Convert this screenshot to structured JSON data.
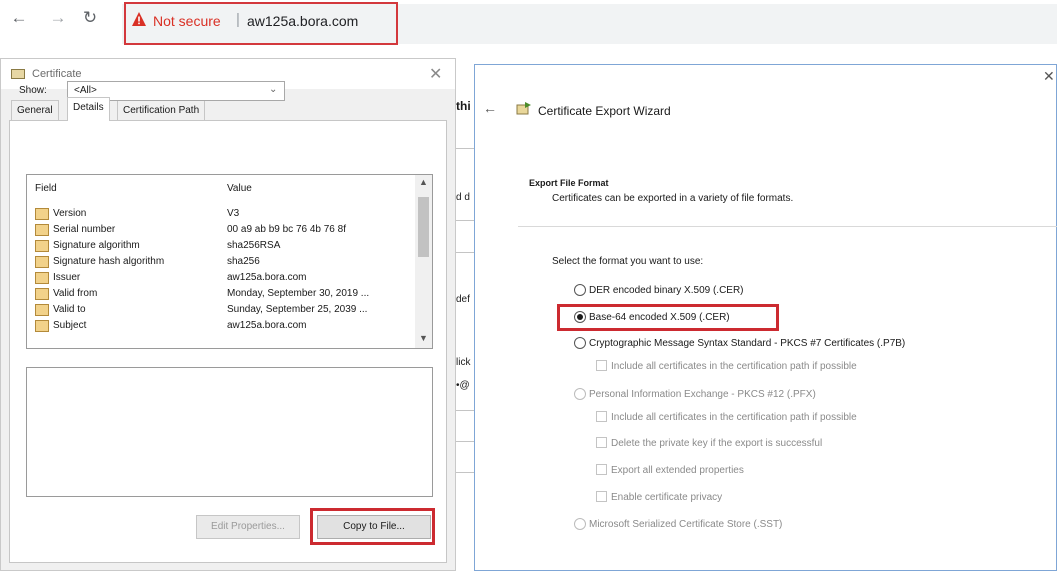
{
  "browser": {
    "back_icon": "arrow-left-icon",
    "forward_icon": "arrow-right-icon",
    "reload_icon": "reload-icon",
    "security_label": "Not secure",
    "separator": "|",
    "url": "aw125a.bora.com",
    "highlight_color": "#d3383c"
  },
  "certificate_dialog": {
    "title": "Certificate",
    "tabs": [
      {
        "label": "General",
        "active": false
      },
      {
        "label": "Details",
        "active": true
      },
      {
        "label": "Certification Path",
        "active": false
      }
    ],
    "show_label": "Show:",
    "show_value": "<All>",
    "columns": {
      "field": "Field",
      "value": "Value"
    },
    "fields": [
      {
        "field": "Version",
        "value": "V3"
      },
      {
        "field": "Serial number",
        "value": "00 a9 ab b9 bc 76 4b 76 8f"
      },
      {
        "field": "Signature algorithm",
        "value": "sha256RSA"
      },
      {
        "field": "Signature hash algorithm",
        "value": "sha256"
      },
      {
        "field": "Issuer",
        "value": "aw125a.bora.com"
      },
      {
        "field": "Valid from",
        "value": "Monday, September 30, 2019 ..."
      },
      {
        "field": "Valid to",
        "value": "Sunday, September 25, 2039 ..."
      },
      {
        "field": "Subject",
        "value": "aw125a.bora.com"
      }
    ],
    "edit_properties_label": "Edit Properties...",
    "copy_to_file_label": "Copy to File..."
  },
  "background_page": {
    "fragments": [
      "thi",
      "d d",
      "def",
      "lick",
      "•@"
    ]
  },
  "export_wizard": {
    "title": "Certificate Export Wizard",
    "section_title": "Export File Format",
    "section_description": "Certificates can be exported in a variety of file formats.",
    "prompt": "Select the format you want to use:",
    "formats": [
      {
        "label": "DER encoded binary X.509 (.CER)",
        "checked": false,
        "enabled": true
      },
      {
        "label": "Base-64 encoded X.509 (.CER)",
        "checked": true,
        "enabled": true
      },
      {
        "label": "Cryptographic Message Syntax Standard - PKCS #7 Certificates (.P7B)",
        "checked": false,
        "enabled": true
      },
      {
        "label": "Personal Information Exchange - PKCS #12 (.PFX)",
        "checked": false,
        "enabled": false
      },
      {
        "label": "Microsoft Serialized Certificate Store (.SST)",
        "checked": false,
        "enabled": false
      }
    ],
    "p7b_options": [
      "Include all certificates in the certification path if possible"
    ],
    "pfx_options": [
      "Include all certificates in the certification path if possible",
      "Delete the private key if the export is successful",
      "Export all extended properties",
      "Enable certificate privacy"
    ]
  }
}
